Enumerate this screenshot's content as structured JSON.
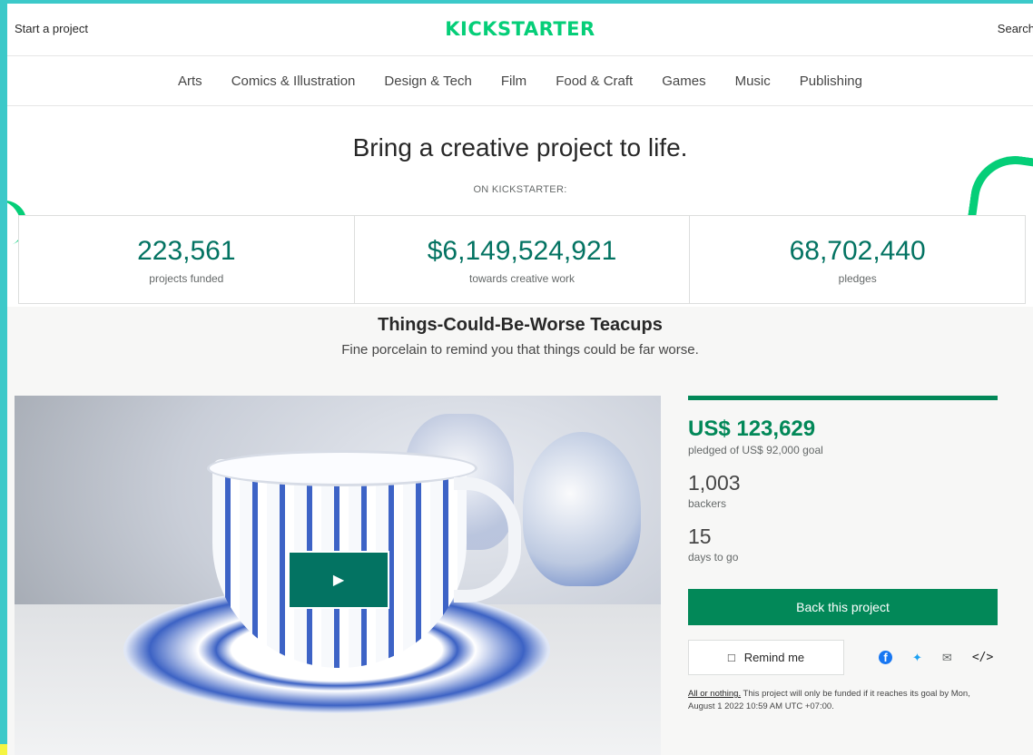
{
  "header": {
    "start_project": "Start a project",
    "logo": "KICKSTARTER",
    "search": "Search"
  },
  "categories": [
    "Arts",
    "Comics & Illustration",
    "Design & Tech",
    "Film",
    "Food & Craft",
    "Games",
    "Music",
    "Publishing"
  ],
  "hero": {
    "tagline": "Bring a creative project to life.",
    "on_kickstarter": "ON KICKSTARTER:",
    "stats": [
      {
        "value": "223,561",
        "label": "projects funded"
      },
      {
        "value": "$6,149,524,921",
        "label": "towards creative work"
      },
      {
        "value": "68,702,440",
        "label": "pledges"
      }
    ]
  },
  "project": {
    "title": "Things-Could-Be-Worse Teacups",
    "blurb": "Fine porcelain to remind you that things could be far worse.",
    "play_icon": "play-icon",
    "pledged": "US$ 123,629",
    "pledged_of": "pledged of US$ 92,000 goal",
    "funding_progress_percent": 100,
    "backers": "1,003",
    "backers_label": "backers",
    "days": "15",
    "days_label": "days to go",
    "back_button": "Back this project",
    "remind_button": "Remind me",
    "embed_icon": "</>",
    "all_or_nothing": "All or nothing.",
    "fine_print": " This project will only be funded if it reaches its goal by Mon, August 1 2022 10:59 AM UTC +07:00."
  },
  "colors": {
    "brand": "#05ce78",
    "accent": "#028858",
    "stat_text": "#037362",
    "background": "#3cc9c9"
  }
}
